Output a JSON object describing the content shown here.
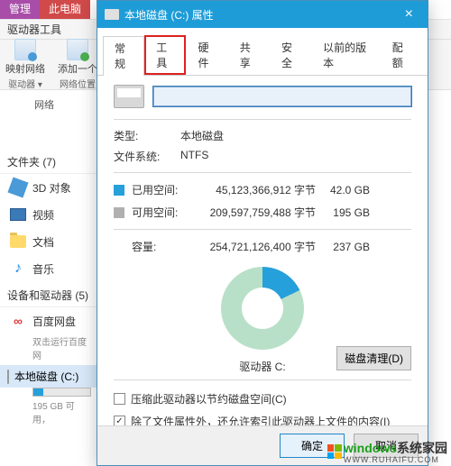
{
  "explorer": {
    "ribbon_tabs": {
      "manage": "管理",
      "this_pc": "此电脑"
    },
    "ribbon_label": "驱动器工具",
    "toolbar": {
      "map_net_drive": "映射网络",
      "map_net_drive_sub": "驱动器 ▾",
      "add_net_loc": "添加一个",
      "add_net_loc_sub": "网络位置",
      "group": "网络"
    },
    "sections": {
      "folders_header": "文件夹 (7)",
      "folders": [
        {
          "name": "3D 对象"
        },
        {
          "name": "视频"
        },
        {
          "name": "文档"
        },
        {
          "name": "音乐"
        }
      ],
      "drives_header": "设备和驱动器 (5)",
      "baidu": {
        "name": "百度网盘",
        "sub": "双击运行百度网"
      },
      "local_c": {
        "name": "本地磁盘 (C:)",
        "sub": "195 GB 可用，"
      }
    }
  },
  "dialog": {
    "title": "本地磁盘 (C:) 属性",
    "tabs": {
      "general": "常规",
      "tools": "工具",
      "hardware": "硬件",
      "sharing": "共享",
      "security": "安全",
      "previous": "以前的版本",
      "quota": "配额"
    },
    "name_value": "",
    "type_label": "类型:",
    "type_value": "本地磁盘",
    "fs_label": "文件系统:",
    "fs_value": "NTFS",
    "used_label": "已用空间:",
    "used_bytes": "45,123,366,912 字节",
    "used_gb": "42.0 GB",
    "free_label": "可用空间:",
    "free_bytes": "209,597,759,488 字节",
    "free_gb": "195 GB",
    "cap_label": "容量:",
    "cap_bytes": "254,721,126,400 字节",
    "cap_gb": "237 GB",
    "drive_label": "驱动器 C:",
    "cleanup_btn": "磁盘清理(D)",
    "chk_compress": "压缩此驱动器以节约磁盘空间(C)",
    "chk_index": "除了文件属性外，还允许索引此驱动器上文件的内容(I)",
    "ok": "确定",
    "cancel": "取消"
  },
  "watermark": {
    "brand": "indows",
    "sub": "WWW.RUHAIFU.COM",
    "tag": "系统家园"
  },
  "chart_data": {
    "type": "pie",
    "title": "驱动器 C:",
    "series": [
      {
        "name": "已用空间",
        "value": 42.0,
        "unit": "GB",
        "color": "#26a0da"
      },
      {
        "name": "可用空间",
        "value": 195,
        "unit": "GB",
        "color": "#b8e0c8"
      }
    ],
    "total": {
      "name": "容量",
      "value": 237,
      "unit": "GB"
    }
  }
}
